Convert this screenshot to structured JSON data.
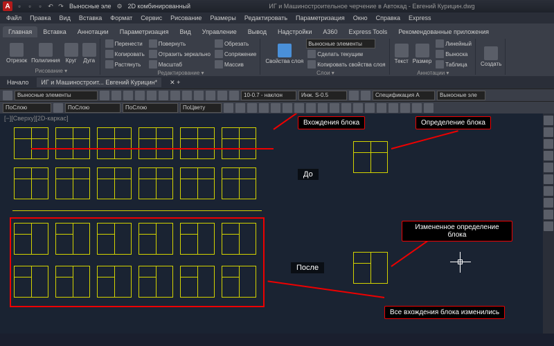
{
  "app": {
    "logo": "A",
    "doc_title": "ИГ и Машиностроительное черчение в Автокад - Евгений Курицин.dwg"
  },
  "qat": {
    "style_label": "Выносные эле",
    "view_label": "2D комбинированный"
  },
  "menu": [
    "Файл",
    "Правка",
    "Вид",
    "Вставка",
    "Формат",
    "Сервис",
    "Рисование",
    "Размеры",
    "Редактировать",
    "Параметризация",
    "Окно",
    "Справка",
    "Express"
  ],
  "tabs": [
    "Главная",
    "Вставка",
    "Аннотации",
    "Параметризация",
    "Вид",
    "Управление",
    "Вывод",
    "Надстройки",
    "A360",
    "Express Tools",
    "Рекомендованные приложения"
  ],
  "ribbon": {
    "draw": {
      "title": "Рисование ▾",
      "btns": [
        "Отрезок",
        "Полилиния",
        "Круг",
        "Дуга"
      ]
    },
    "edit": {
      "title": "Редактирование ▾",
      "r1": [
        "Перенести",
        "Повернуть",
        "Обрезать"
      ],
      "r2": [
        "Копировать",
        "Отразить зеркально",
        "Сопряжение"
      ],
      "r3": [
        "Растянуть",
        "Масштаб",
        "Массив"
      ]
    },
    "layers": {
      "title": "Слои ▾",
      "main": "Свойства слоя",
      "combo": "Выносные элементы",
      "r1": "Сделать текущим",
      "r2": "Копировать свойства слоя"
    },
    "anno": {
      "title": "Аннотации ▾",
      "btns": [
        "Текст",
        "Размер"
      ],
      "r1": "Линейный",
      "r2": "Выноска",
      "r3": "Таблица"
    },
    "create": {
      "label": "Создать"
    }
  },
  "doctabs": {
    "start": "Начало",
    "active": "ИГ и Машиностроит... Евгений Курицин*"
  },
  "tb1": {
    "layer": "Выносные элементы"
  },
  "tb2": {
    "c1": "ПоСлою",
    "c2": "ПоСлою",
    "c3": "ПоСлою",
    "c4": "ПоЦвету",
    "style1": "10-0.7 - наклон",
    "style2": "Инж. S-0.5",
    "style3": "Спецификация А",
    "style4": "Выносные эле"
  },
  "canvas": {
    "view_label": "[−][Сверху][2D-каркас]",
    "anno1": "Вхождения блока",
    "anno2": "Определение блока",
    "anno3": "Измененное определение блока",
    "anno4": "Все вхождения блока изменились",
    "label_before": "До",
    "label_after": "После"
  }
}
